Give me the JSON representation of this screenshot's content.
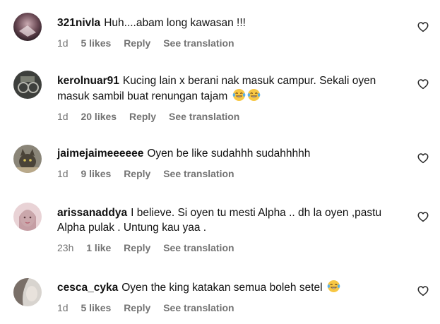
{
  "comments": [
    {
      "username": "321nivla",
      "text": "Huh....abam long kawasan !!!",
      "emojis": [],
      "time": "1d",
      "likes": "5 likes",
      "reply": "Reply",
      "translate": "See translation",
      "avatar_icon": "avatar-dark-gradient"
    },
    {
      "username": "kerolnuar91",
      "text": "Kucing lain x berani nak masuk campur. Sekali oyen masuk sambil buat renungan tajam",
      "emojis": [
        "laughing-tears-emoji",
        "laughing-tears-emoji"
      ],
      "time": "1d",
      "likes": "20 likes",
      "reply": "Reply",
      "translate": "See translation",
      "avatar_icon": "avatar-dark-photo"
    },
    {
      "username": "jaimejaimeeeeee",
      "text": "Oyen be like sudahhh sudahhhhh",
      "emojis": [],
      "time": "1d",
      "likes": "9 likes",
      "reply": "Reply",
      "translate": "See translation",
      "avatar_icon": "avatar-cat-photo"
    },
    {
      "username": "arissanaddya",
      "text": "I believe. Si oyen tu mesti Alpha .. dh la oyen ,pastu Alpha pulak . Untung kau yaa .",
      "emojis": [],
      "time": "23h",
      "likes": "1 like",
      "reply": "Reply",
      "translate": "See translation",
      "avatar_icon": "avatar-pink-photo"
    },
    {
      "username": "cesca_cyka",
      "text": "Oyen the king katakan semua boleh setel",
      "emojis": [
        "laughing-tears-emoji"
      ],
      "time": "1d",
      "likes": "5 likes",
      "reply": "Reply",
      "translate": "See translation",
      "avatar_icon": "avatar-light-photo"
    }
  ],
  "colors": {
    "text": "#111111",
    "meta": "#737373",
    "background": "#ffffff",
    "emoji_face": "#f7c744"
  }
}
